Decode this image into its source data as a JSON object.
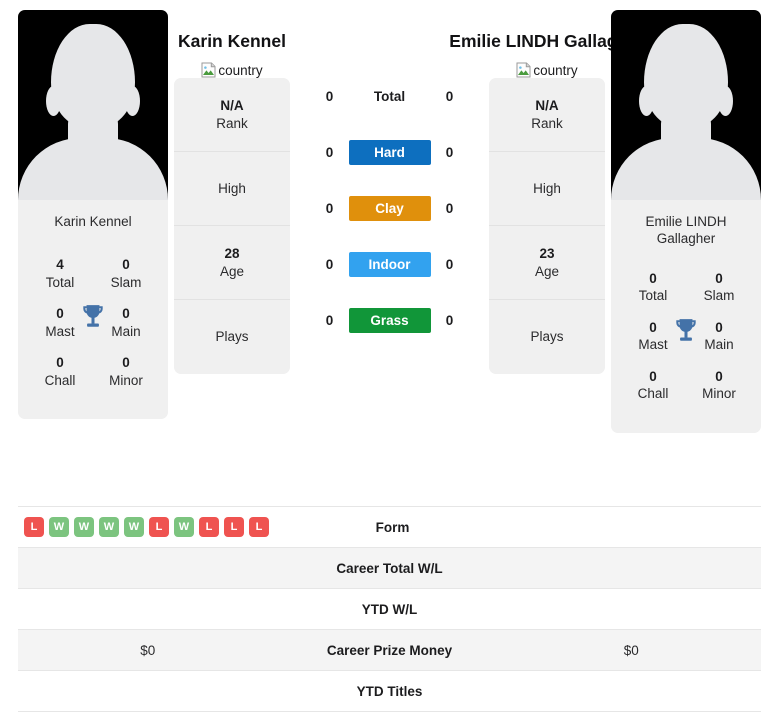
{
  "colors": {
    "hard": "#0d6fbf",
    "clay": "#e0900c",
    "indoor": "#32a2ef",
    "grass": "#119639",
    "win": "#7cc47f",
    "loss": "#ef5350",
    "trophy": "#4472a8",
    "card_bg": "#f0f0f0",
    "row_shaded": "#f4f4f4"
  },
  "left_player": {
    "name": "Karin Kennel",
    "photo_caption": "Karin Kennel",
    "country_alt": "country",
    "country_icon": "broken-image-icon",
    "titles": [
      {
        "value": "4",
        "label": "Total"
      },
      {
        "value": "0",
        "label": "Slam"
      },
      {
        "value": "0",
        "label": "Mast"
      },
      {
        "value": "0",
        "label": "Main"
      },
      {
        "value": "0",
        "label": "Chall"
      },
      {
        "value": "0",
        "label": "Minor"
      }
    ],
    "info": [
      {
        "value": "N/A",
        "label": "Rank"
      },
      {
        "value": "",
        "label": "High"
      },
      {
        "value": "28",
        "label": "Age"
      },
      {
        "value": "",
        "label": "Plays"
      }
    ],
    "form": [
      "L",
      "W",
      "W",
      "W",
      "W",
      "L",
      "W",
      "L",
      "L",
      "L"
    ],
    "career_total_wl": "",
    "ytd_wl": "",
    "career_prize_money": "$0",
    "ytd_titles": ""
  },
  "right_player": {
    "name": "Emilie LINDH Gallagher",
    "photo_caption": "Emilie LINDH Gallagher",
    "country_alt": "country",
    "country_icon": "broken-image-icon",
    "titles": [
      {
        "value": "0",
        "label": "Total"
      },
      {
        "value": "0",
        "label": "Slam"
      },
      {
        "value": "0",
        "label": "Mast"
      },
      {
        "value": "0",
        "label": "Main"
      },
      {
        "value": "0",
        "label": "Chall"
      },
      {
        "value": "0",
        "label": "Minor"
      }
    ],
    "info": [
      {
        "value": "N/A",
        "label": "Rank"
      },
      {
        "value": "",
        "label": "High"
      },
      {
        "value": "23",
        "label": "Age"
      },
      {
        "value": "",
        "label": "Plays"
      }
    ],
    "form": [],
    "career_total_wl": "",
    "ytd_wl": "",
    "career_prize_money": "$0",
    "ytd_titles": ""
  },
  "head_to_head": [
    {
      "left": "0",
      "label": "Total",
      "right": "0",
      "style": "plain"
    },
    {
      "left": "0",
      "label": "Hard",
      "right": "0",
      "style": "badge",
      "color_key": "hard"
    },
    {
      "left": "0",
      "label": "Clay",
      "right": "0",
      "style": "badge",
      "color_key": "clay"
    },
    {
      "left": "0",
      "label": "Indoor",
      "right": "0",
      "style": "badge",
      "color_key": "indoor"
    },
    {
      "left": "0",
      "label": "Grass",
      "right": "0",
      "style": "badge",
      "color_key": "grass"
    }
  ],
  "stats_rows": [
    {
      "label": "Form",
      "left": "",
      "right": "",
      "shaded": false,
      "type": "form"
    },
    {
      "label": "Career Total W/L",
      "left": "",
      "right": "",
      "shaded": true,
      "type": "text"
    },
    {
      "label": "YTD W/L",
      "left": "",
      "right": "",
      "shaded": false,
      "type": "text"
    },
    {
      "label": "Career Prize Money",
      "left": "$0",
      "right": "$0",
      "shaded": true,
      "type": "text"
    },
    {
      "label": "YTD Titles",
      "left": "",
      "right": "",
      "shaded": false,
      "type": "text"
    }
  ]
}
